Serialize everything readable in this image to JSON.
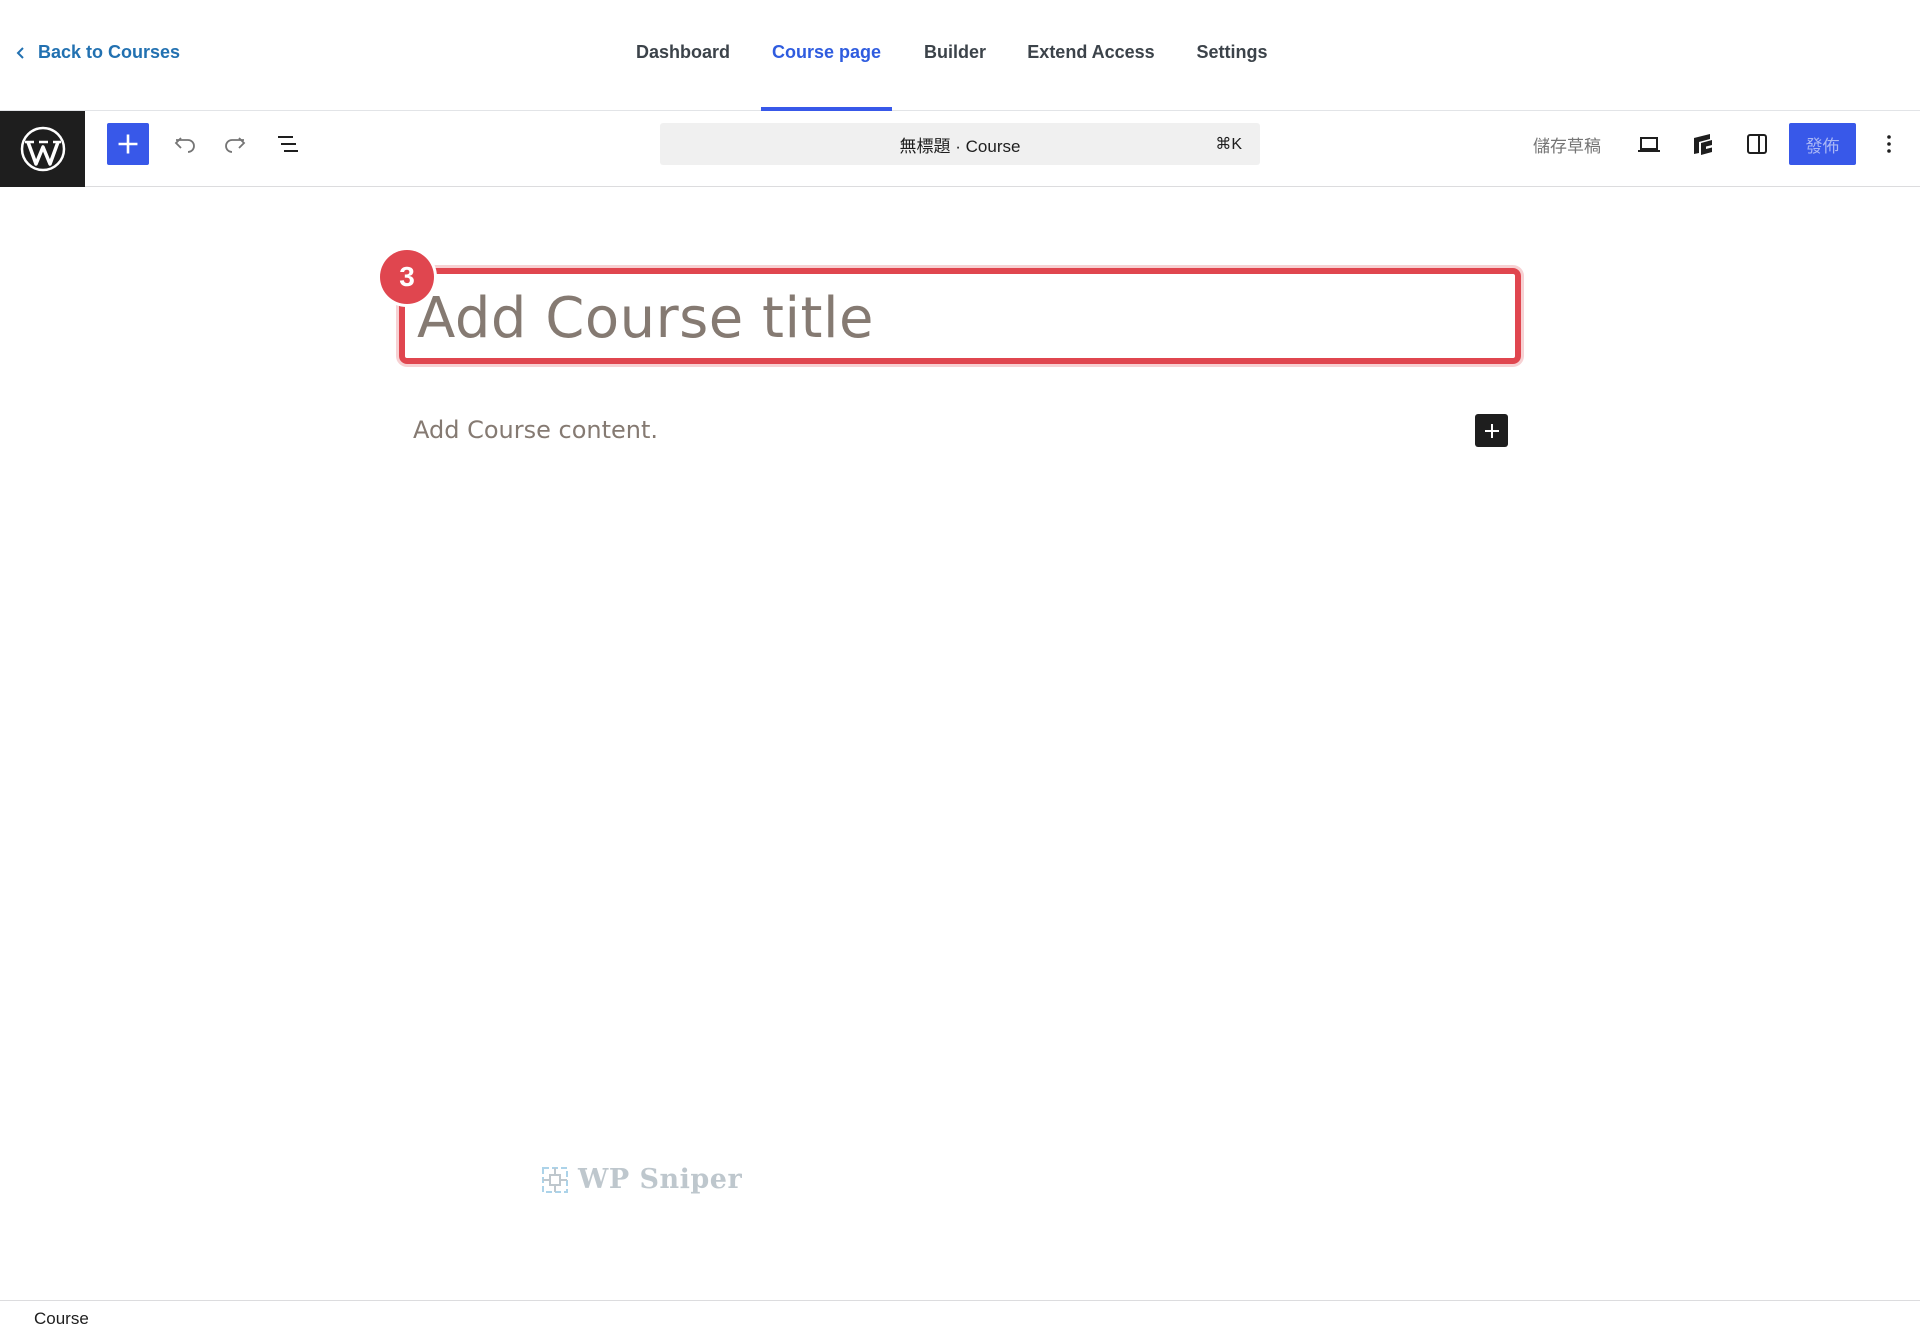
{
  "course_nav": {
    "back_label": "Back to Courses",
    "tabs": [
      {
        "label": "Dashboard",
        "active": false
      },
      {
        "label": "Course page",
        "active": true
      },
      {
        "label": "Builder",
        "active": false
      },
      {
        "label": "Extend Access",
        "active": false
      },
      {
        "label": "Settings",
        "active": false
      }
    ]
  },
  "toolbar": {
    "document_title": "無標題 · Course",
    "shortcut": "⌘K",
    "save_draft_label": "儲存草稿",
    "publish_label": "發佈",
    "icons": [
      "wordpress-logo-icon",
      "plus-icon",
      "undo-icon",
      "redo-icon",
      "list-view-icon",
      "desktop-preview-icon",
      "brand-icon",
      "sidebar-toggle-icon",
      "more-vertical-icon"
    ]
  },
  "editor": {
    "title_placeholder": "Add Course title",
    "content_placeholder": "Add Course content.",
    "step_badge": "3"
  },
  "watermark": {
    "text": "WP Sniper"
  },
  "footer": {
    "breadcrumb": "Course"
  },
  "colors": {
    "accent": "#3858e9",
    "link": "#2271b1",
    "highlight": "#e0464f",
    "placeholder": "#857a72"
  }
}
